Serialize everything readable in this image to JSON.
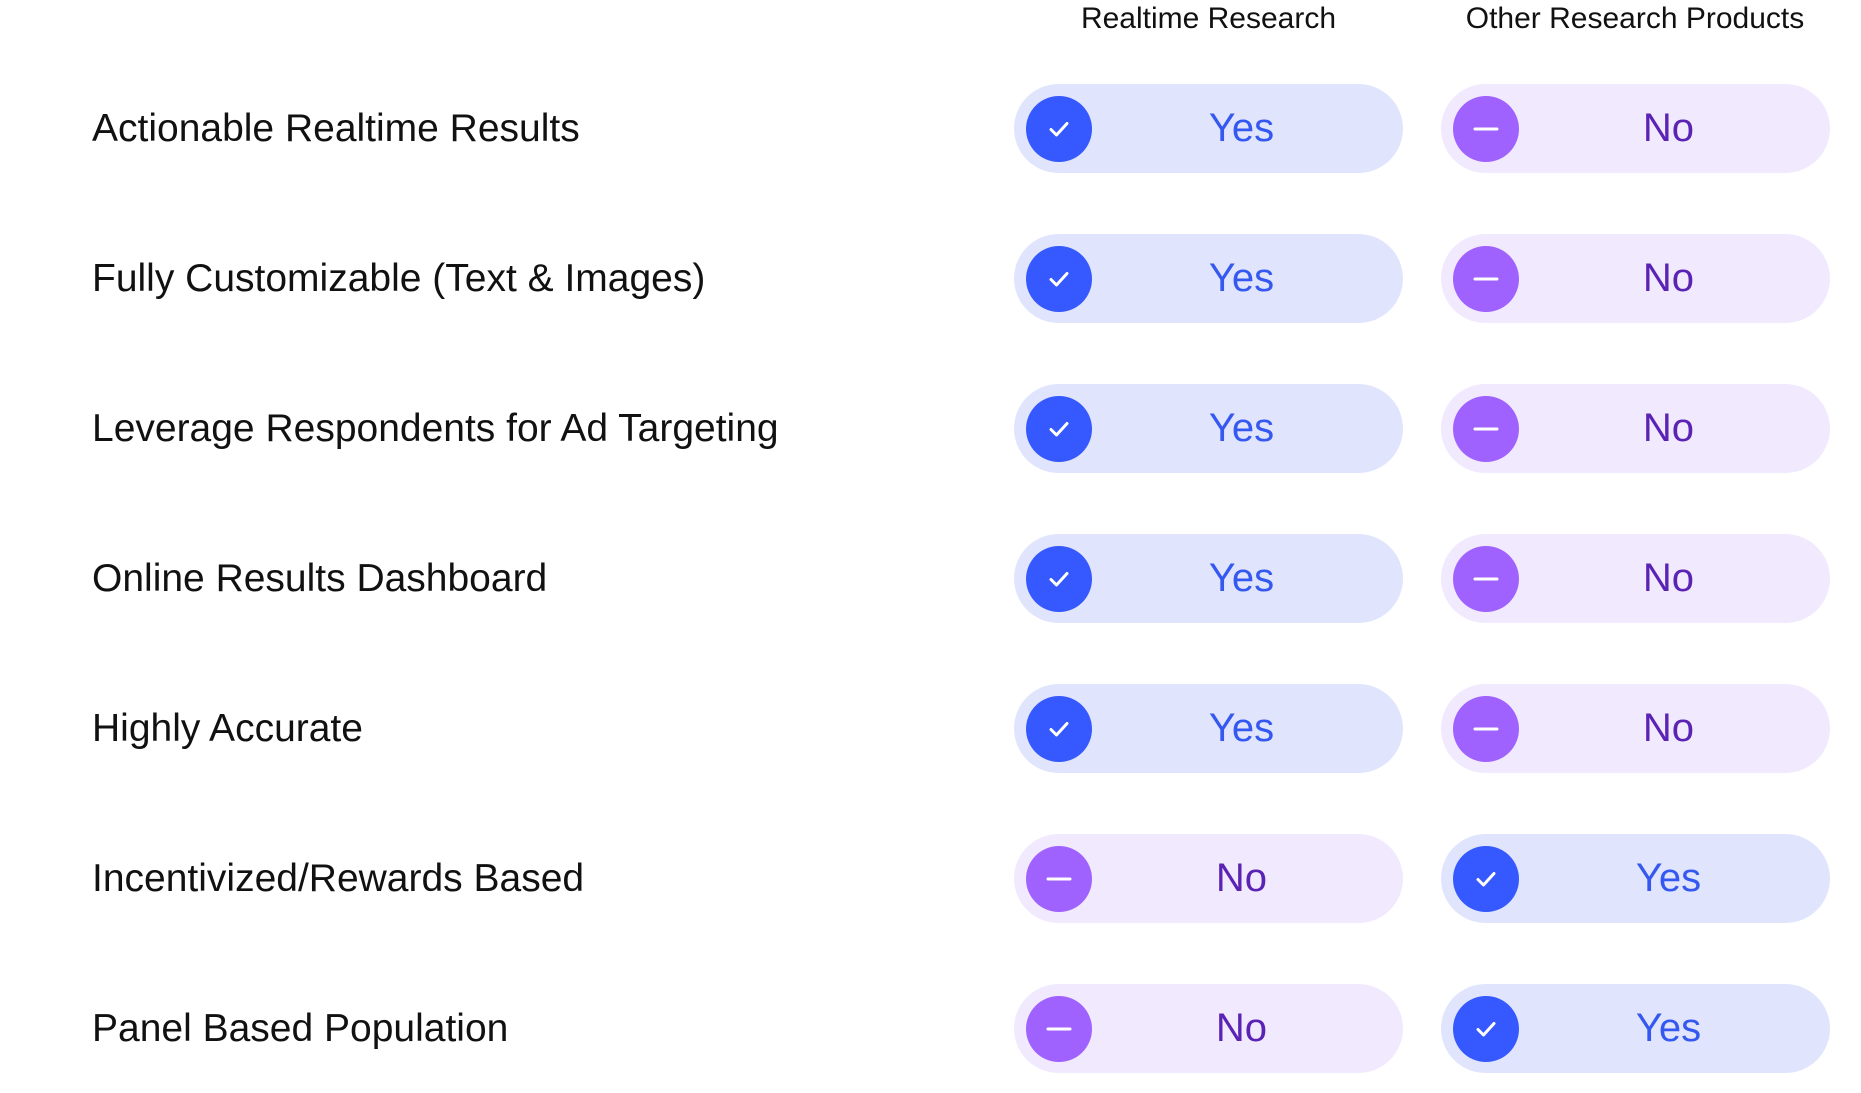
{
  "columns": [
    "Realtime Research",
    "Other Research Products"
  ],
  "colors": {
    "yes_circle": "#3558ff",
    "yes_bg": "#e0e5fd",
    "yes_text": "#3558f0",
    "no_circle": "#a062ff",
    "no_bg": "#f1e9fe",
    "no_text": "#5b23b4"
  },
  "rows": [
    {
      "feature": "Actionable Realtime Results",
      "values": [
        {
          "label": "Yes",
          "icon": "check-icon"
        },
        {
          "label": "No",
          "icon": "minus-icon"
        }
      ]
    },
    {
      "feature": "Fully Customizable (Text & Images)",
      "values": [
        {
          "label": "Yes",
          "icon": "check-icon"
        },
        {
          "label": "No",
          "icon": "minus-icon"
        }
      ]
    },
    {
      "feature": "Leverage Respondents for Ad Targeting",
      "values": [
        {
          "label": "Yes",
          "icon": "check-icon"
        },
        {
          "label": "No",
          "icon": "minus-icon"
        }
      ]
    },
    {
      "feature": "Online Results Dashboard",
      "values": [
        {
          "label": "Yes",
          "icon": "check-icon"
        },
        {
          "label": "No",
          "icon": "minus-icon"
        }
      ]
    },
    {
      "feature": "Highly Accurate",
      "values": [
        {
          "label": "Yes",
          "icon": "check-icon"
        },
        {
          "label": "No",
          "icon": "minus-icon"
        }
      ]
    },
    {
      "feature": "Incentivized/Rewards Based",
      "values": [
        {
          "label": "No",
          "icon": "minus-icon"
        },
        {
          "label": "Yes",
          "icon": "check-icon"
        }
      ]
    },
    {
      "feature": "Panel Based Population",
      "values": [
        {
          "label": "No",
          "icon": "minus-icon"
        },
        {
          "label": "Yes",
          "icon": "check-icon"
        }
      ]
    }
  ]
}
